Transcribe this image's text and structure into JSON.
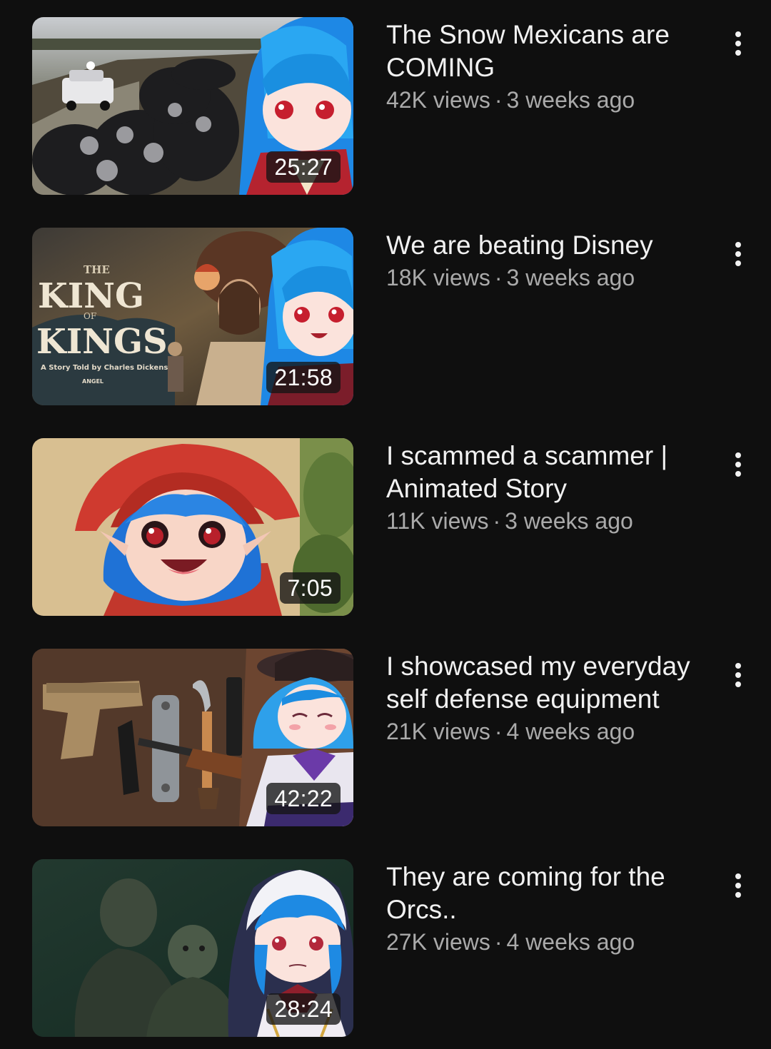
{
  "videos": [
    {
      "title": "The Snow Mexicans are COMING",
      "views": "42K views",
      "age": "3 weeks ago",
      "duration": "25:27"
    },
    {
      "title": "We are beating Disney",
      "views": "18K views",
      "age": "3 weeks ago",
      "duration": "21:58",
      "thumb_text": {
        "the": "THE",
        "king": "KING",
        "of": "OF",
        "kings": "KINGS",
        "tagline": "A Story Told by Charles Dickens",
        "credit": "ANGEL"
      }
    },
    {
      "title": "I scammed a scammer | Animated Story",
      "views": "11K views",
      "age": "3 weeks ago",
      "duration": "7:05"
    },
    {
      "title": "I showcased my everyday self defense equipment",
      "views": "21K views",
      "age": "4 weeks ago",
      "duration": "42:22"
    },
    {
      "title": "They are coming for the Orcs..",
      "views": "27K views",
      "age": "4 weeks ago",
      "duration": "28:24"
    }
  ],
  "separator": "·",
  "icons": {
    "menu": "more-vert-icon"
  },
  "colors": {
    "background": "#0f0f0f",
    "title": "#f1f1f1",
    "meta": "#aaaaaa"
  }
}
